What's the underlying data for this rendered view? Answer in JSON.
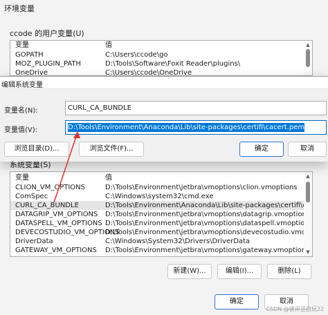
{
  "background_window": {
    "title": "环境变量",
    "user_vars_label": "ccode 的用户变量(U)",
    "user_list": {
      "col_var": "变量",
      "col_val": "值",
      "rows": [
        {
          "name": "GOPATH",
          "value": "C:\\Users\\ccode\\go"
        },
        {
          "name": "MOZ_PLUGIN_PATH",
          "value": "D:\\Tools\\Software\\Foxit Reader\\plugins\\"
        },
        {
          "name": "OneDrive",
          "value": "C:\\Users\\ccode\\OneDrive"
        }
      ]
    },
    "sys_vars_label": "系统变量(S)",
    "sys_list": {
      "col_var": "变量",
      "col_val": "值",
      "rows": [
        {
          "name": "CLION_VM_OPTIONS",
          "value": "D:\\Tools\\Environment\\jetbra\\vmoptions\\clion.vmoptions"
        },
        {
          "name": "ComSpec",
          "value": "C:\\Windows\\system32\\cmd.exe"
        },
        {
          "name": "CURL_CA_BUNDLE",
          "value": "D:\\Tools\\Environment\\Anaconda\\Lib\\site-packages\\certifi\\cacert.pem"
        },
        {
          "name": "DATAGRIP_VM_OPTIONS",
          "value": "D:\\Tools\\Environment\\jetbra\\vmoptions\\datagrip.vmoptions"
        },
        {
          "name": "DATASPELL_VM_OPTIONS",
          "value": "D:\\Tools\\Environment\\jetbra\\vmoptions\\dataspell.vmoptions"
        },
        {
          "name": "DEVECOSTUDIO_VM_OPTIONS",
          "value": "D:\\Tools\\Environment\\jetbra\\vmoptions\\devecostudio.vmoptions"
        },
        {
          "name": "DriverData",
          "value": "C:\\Windows\\System32\\Drivers\\DriverData"
        },
        {
          "name": "GATEWAY_VM_OPTIONS",
          "value": "D:\\Tools\\Environment\\jetbra\\vmoptions\\gateway.vmoptions"
        }
      ],
      "selected_index": 2
    },
    "new_button": "新建(W)...",
    "edit_button": "编辑(I)...",
    "delete_button": "删除(L)",
    "ok_button": "确定",
    "cancel_button": "取消"
  },
  "edit_dialog": {
    "title": "编辑系统变量",
    "name_label": "变量名(N):",
    "name_value": "CURL_CA_BUNDLE",
    "value_label": "变量值(V):",
    "value_value": "D:\\Tools\\Environment\\Anaconda\\Lib\\site-packages\\certifi\\cacert.pem",
    "browse_dir_button": "浏览目录(D)...",
    "browse_file_button": "浏览文件(F)...",
    "ok_button": "确定",
    "cancel_button": "取消"
  },
  "annotation_color": "#e03030",
  "watermark": "CSDN @彼岸亘自玩22"
}
